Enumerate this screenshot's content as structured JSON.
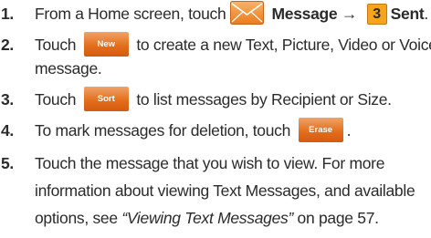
{
  "steps": [
    {
      "num": "1.",
      "t1": "From a Home screen, touch",
      "bold1": "Message →",
      "key": "3",
      "bold2": "Sent",
      "end": "."
    },
    {
      "num": "2.",
      "t1": "Touch",
      "btn": "New",
      "t2": "to create a new Text, Picture, Video or Voice",
      "line2": "message."
    },
    {
      "num": "3.",
      "t1": "Touch",
      "btn": "Sort",
      "t2": "to list messages by Recipient or Size."
    },
    {
      "num": "4.",
      "t1": "To mark messages for deletion, touch",
      "btn": "Erase",
      "end": "."
    },
    {
      "num": "5.",
      "line1": "Touch the message that you wish to view. For more",
      "line2": "information about viewing Text Messages, and available",
      "line3a": "options, see",
      "link": "“Viewing Text Messages”",
      "line3b": "on page 57."
    }
  ],
  "icons": {
    "message": "envelope-icon"
  },
  "colors": {
    "softkey": "#e46f1c",
    "key_number": "#f6a31e",
    "envelope": "#f08a2c"
  }
}
